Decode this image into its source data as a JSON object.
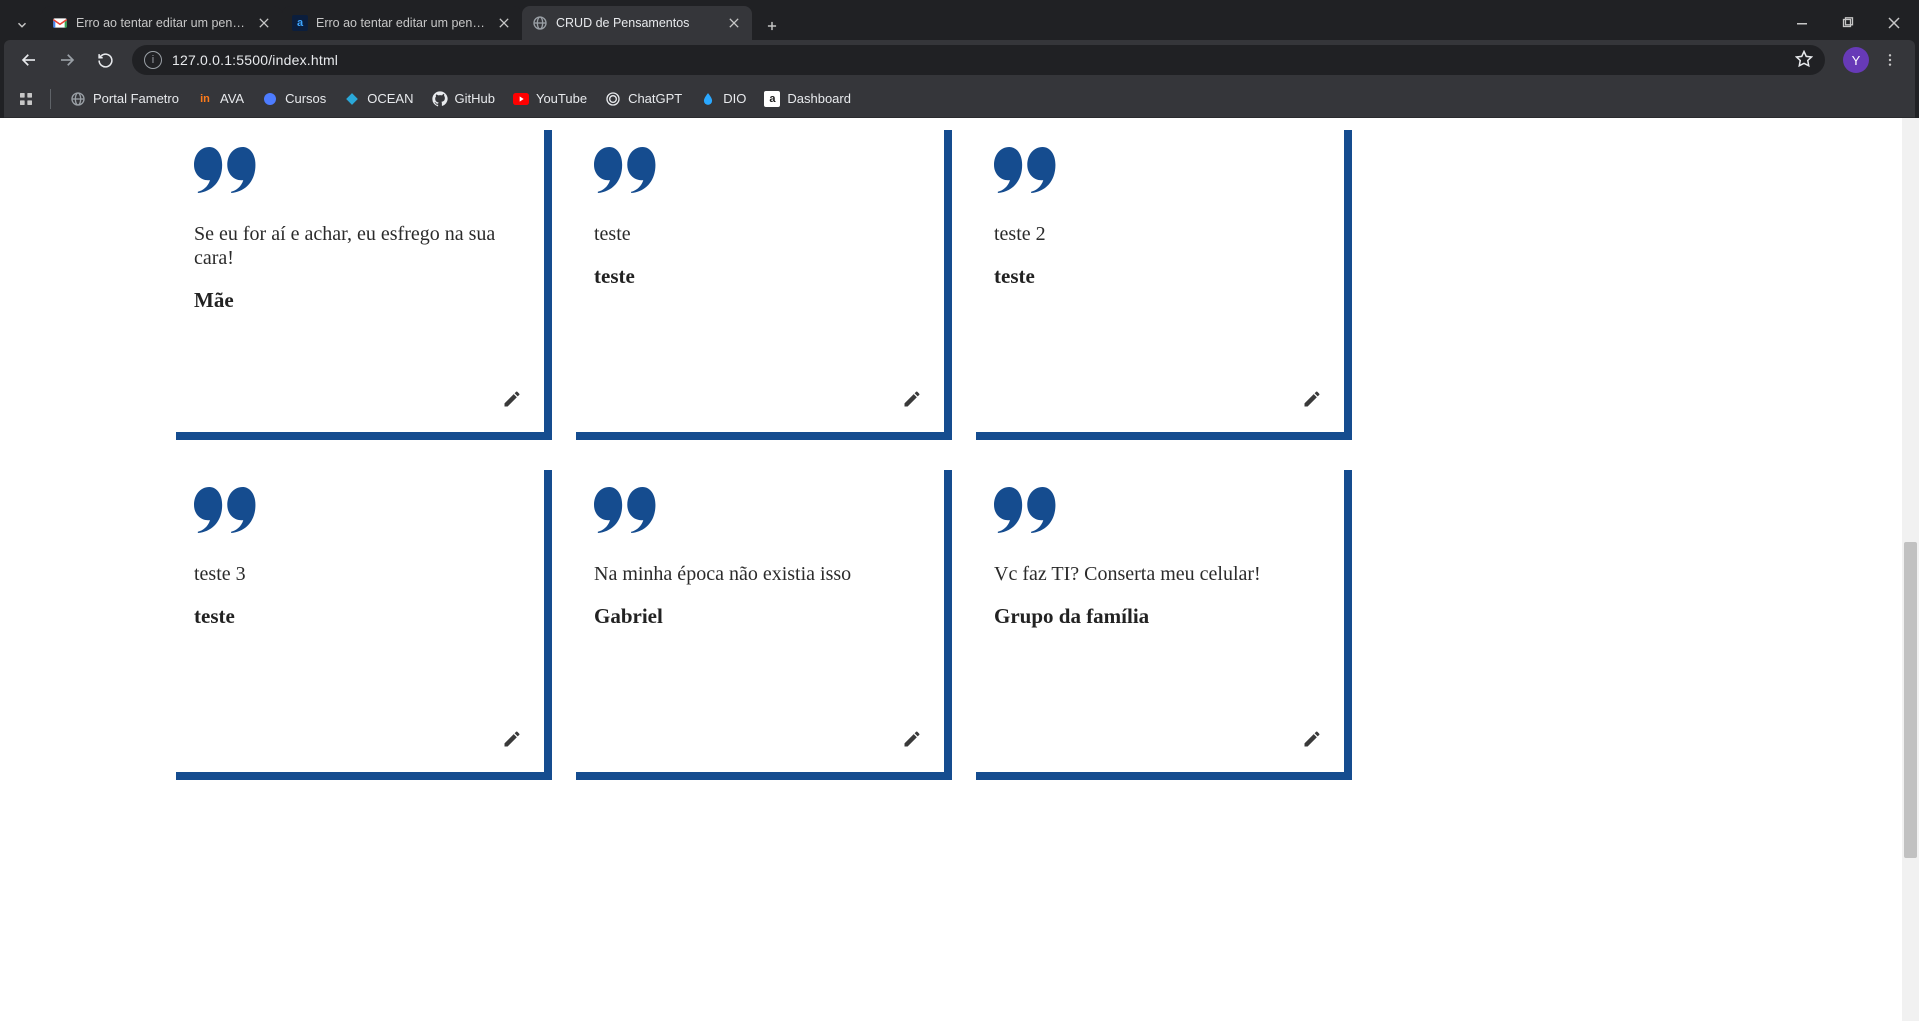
{
  "browser": {
    "tabs": [
      {
        "title": "Erro ao tentar editar um pensar",
        "favicon": "gmail",
        "active": false
      },
      {
        "title": "Erro ao tentar editar um pensar",
        "favicon": "alura",
        "active": false
      },
      {
        "title": "CRUD de Pensamentos",
        "favicon": "globe",
        "active": true
      }
    ],
    "url": "127.0.0.1:5500/index.html",
    "avatar_letter": "Y"
  },
  "bookmarks": [
    {
      "label": "Portal Fametro",
      "icon": "globe",
      "icon_bg": "",
      "icon_color": "#9aa0a6"
    },
    {
      "label": "AVA",
      "icon": "text",
      "icon_text": "in",
      "icon_bg": "",
      "icon_color": "#ff7b1a"
    },
    {
      "label": "Cursos",
      "icon": "dot",
      "icon_bg": "",
      "icon_color": "#4d7cff"
    },
    {
      "label": "OCEAN",
      "icon": "diamond",
      "icon_bg": "",
      "icon_color": "#2aa8d8"
    },
    {
      "label": "GitHub",
      "icon": "github",
      "icon_bg": "",
      "icon_color": "#e8eaed"
    },
    {
      "label": "YouTube",
      "icon": "youtube",
      "icon_bg": "",
      "icon_color": "#ff0000"
    },
    {
      "label": "ChatGPT",
      "icon": "spiral",
      "icon_bg": "",
      "icon_color": "#e8eaed"
    },
    {
      "label": "DIO",
      "icon": "drop",
      "icon_bg": "",
      "icon_color": "#2aa8ff"
    },
    {
      "label": "Dashboard",
      "icon": "text",
      "icon_text": "a",
      "icon_bg": "#ffffff",
      "icon_color": "#1b1b1b"
    }
  ],
  "cards": [
    {
      "content": "Se eu for aí e achar, eu esfrego na sua cara!",
      "author": "Mãe"
    },
    {
      "content": "teste",
      "author": "teste"
    },
    {
      "content": "teste 2",
      "author": "teste"
    },
    {
      "content": "teste 3",
      "author": "teste"
    },
    {
      "content": "Na minha época não existia isso",
      "author": "Gabriel"
    },
    {
      "content": "Vc faz TI? Conserta meu celular!",
      "author": "Grupo da família"
    }
  ],
  "colors": {
    "brand_blue": "#154c8f"
  },
  "scrollbar": {
    "thumb_top_pct": 47,
    "thumb_height_pct": 35
  }
}
